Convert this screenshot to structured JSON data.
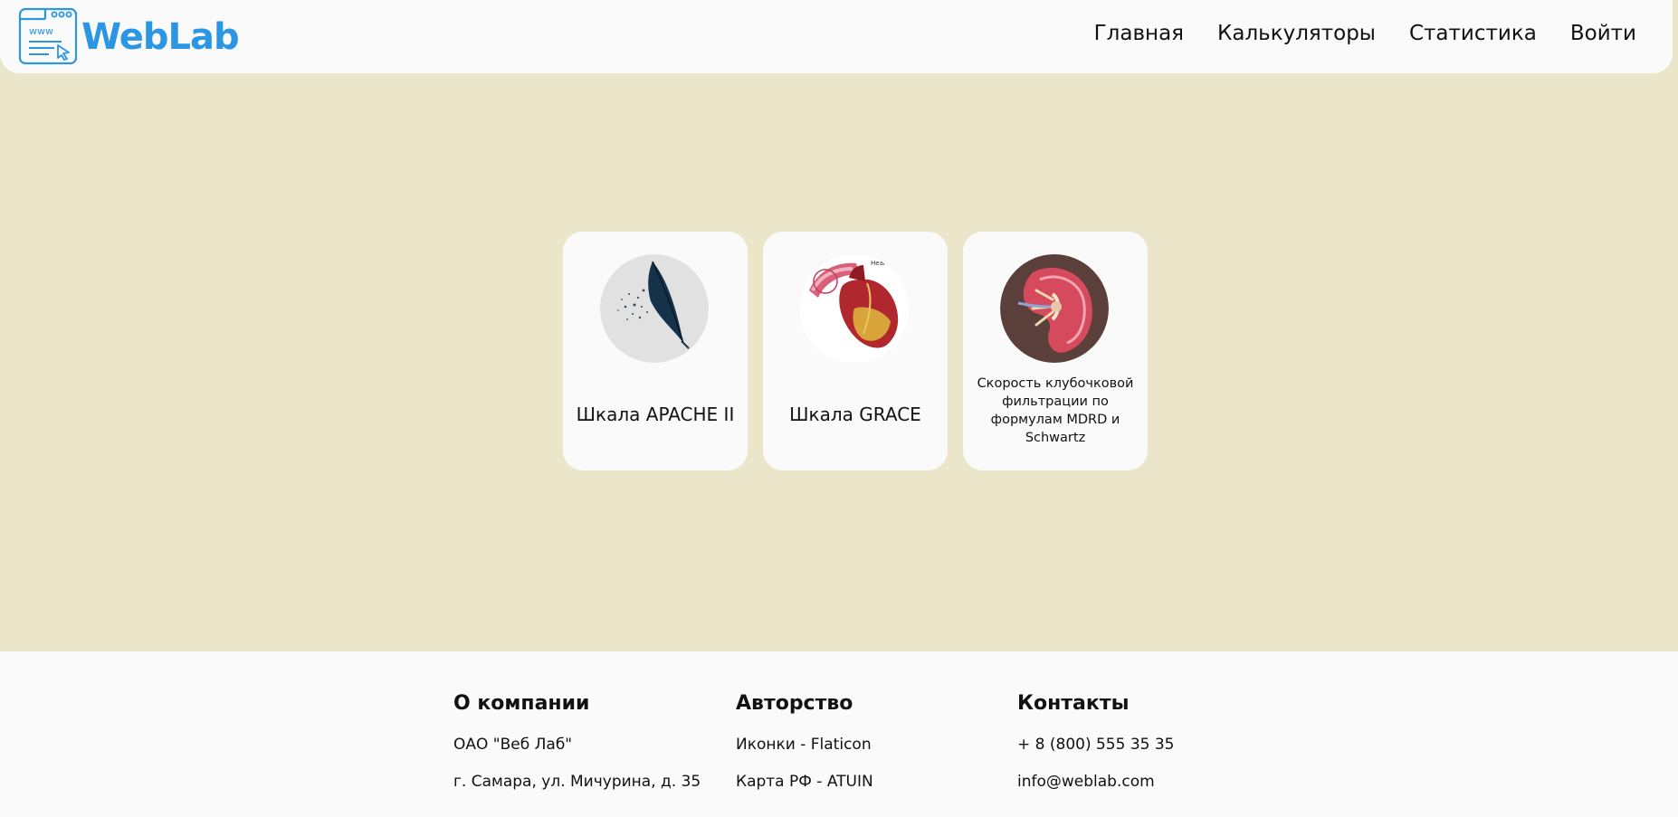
{
  "header": {
    "logo_text": "WebLab",
    "logo_icon_text": "www",
    "nav": [
      "Главная",
      "Калькуляторы",
      "Статистика",
      "Войти"
    ]
  },
  "cards": [
    {
      "title": "Шкала APACHE II",
      "image": "feather-image"
    },
    {
      "title": "Шкала GRACE",
      "image": "heart-image",
      "image_caption": "Heart"
    },
    {
      "title": "Скорость клубочковой фильтрации по формулам MDRD и Schwartz",
      "image": "kidney-image"
    }
  ],
  "footer": {
    "about": {
      "title": "О компании",
      "lines": [
        "ОАО \"Веб Лаб\"",
        "г. Самара, ул. Мичурина, д. 35"
      ]
    },
    "authorship": {
      "title": "Авторство",
      "lines": [
        "Иконки - Flaticon",
        "Карта РФ - ATUIN"
      ]
    },
    "contacts": {
      "title": "Контакты",
      "lines": [
        "+ 8 (800) 555 35 35",
        "info@weblab.com"
      ]
    }
  },
  "colors": {
    "background": "#ebe6c9",
    "surface": "#fafafa",
    "brand": "#2b96e3",
    "text": "#111111"
  }
}
